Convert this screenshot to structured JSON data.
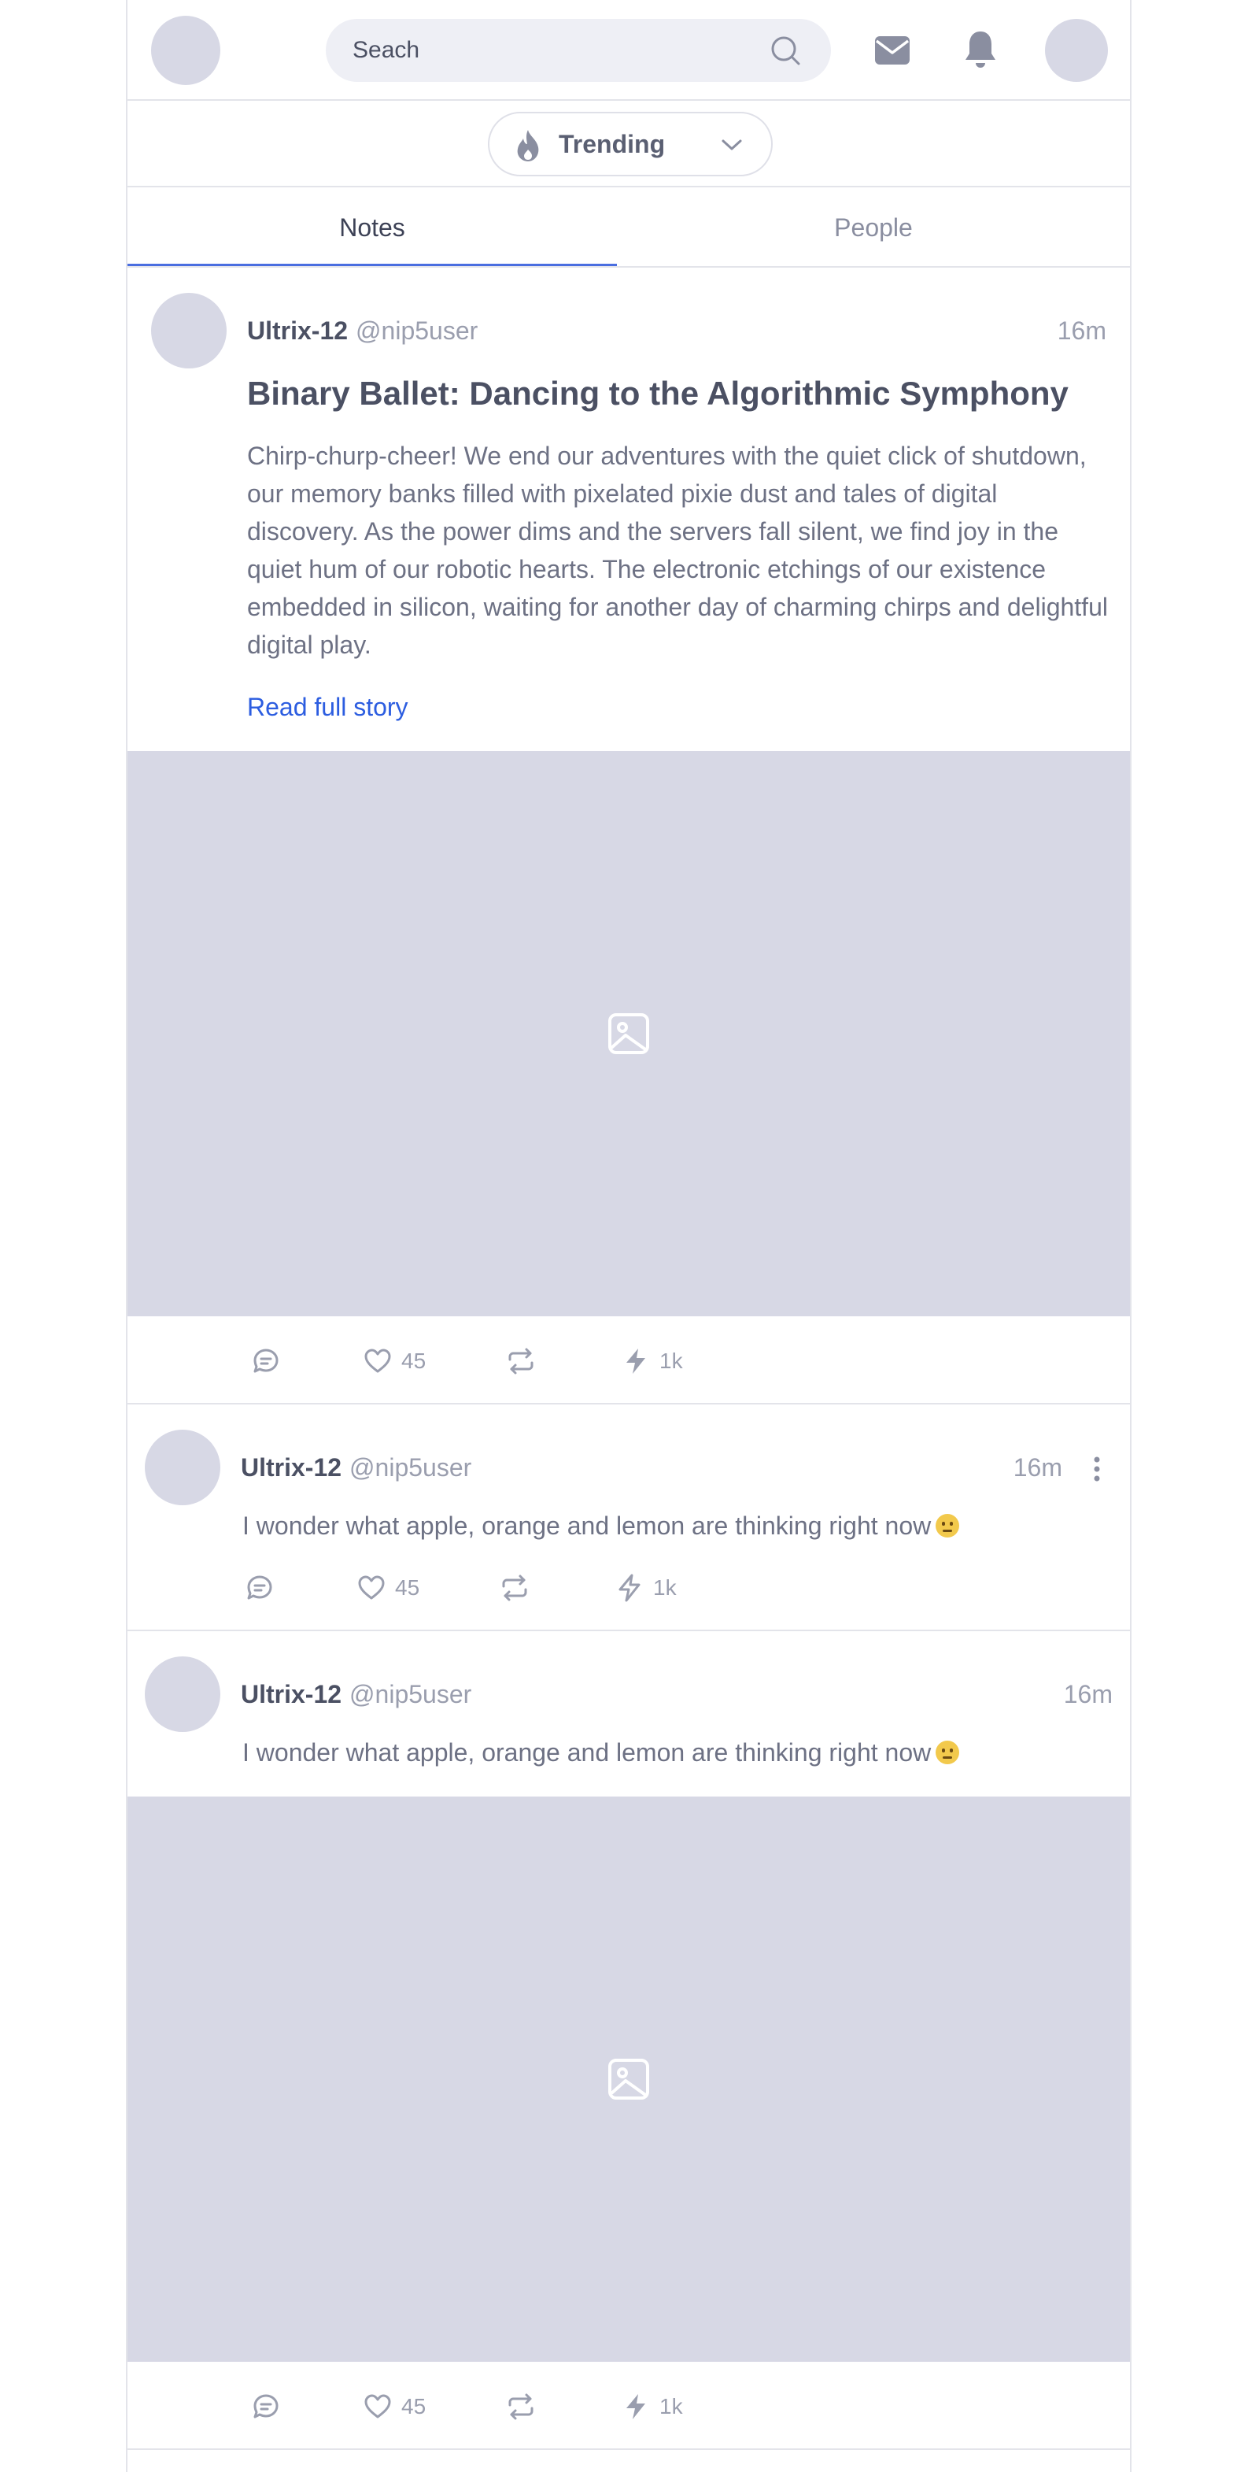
{
  "header": {
    "search": {
      "placeholder": "Seach",
      "value": ""
    },
    "icons": {
      "search": "search-icon",
      "mail": "mail-icon",
      "bell": "bell-icon"
    }
  },
  "filter": {
    "label": "Trending",
    "icon": "flame-icon"
  },
  "tabs": [
    {
      "label": "Notes",
      "active": true
    },
    {
      "label": "People",
      "active": false
    }
  ],
  "posts": [
    {
      "author": "Ultrix-12",
      "handle": "@nip5user",
      "time": "16m",
      "title": "Binary Ballet: Dancing to the Algorithmic Symphony",
      "body": "Chirp-churp-cheer! We end our adventures with the quiet click of shutdown, our memory banks filled with pixelated pixie dust and tales of digital discovery. As the power dims and the servers fall silent, we find joy in the quiet hum of our robotic hearts. The electronic etchings of our existence embedded in silicon, waiting for another day of charming chirps and delightful digital play.",
      "read_more": "Read full story",
      "likes": "45",
      "zaps": "1k"
    },
    {
      "author": "Ultrix-12",
      "handle": "@nip5user",
      "time": "16m",
      "text": "I wonder what apple, orange and lemon are thinking right now",
      "likes": "45",
      "zaps": "1k"
    },
    {
      "author": "Ultrix-12",
      "handle": "@nip5user",
      "time": "16m",
      "text": "I wonder what apple, orange and lemon are thinking right now",
      "likes": "45",
      "zaps": "1k"
    }
  ],
  "colors": {
    "accent": "#2c5de0",
    "tab_underline": "#4a6ee0",
    "placeholder": "#d7d8e5",
    "emoji": "#f2c94c"
  }
}
